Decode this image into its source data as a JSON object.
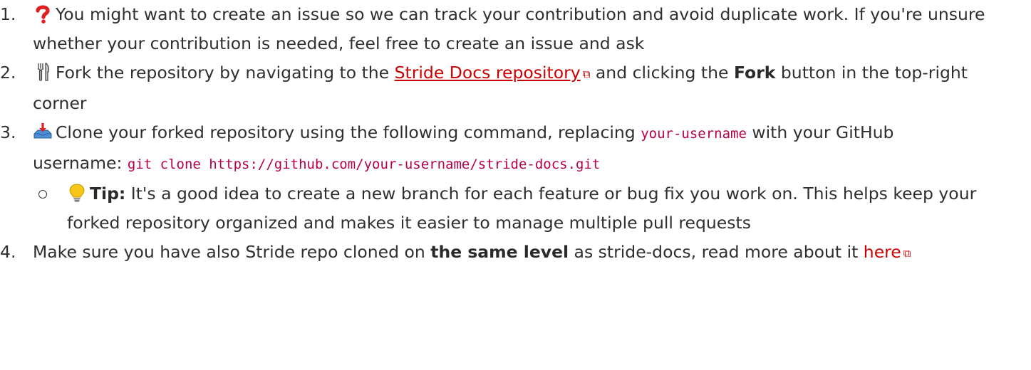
{
  "items": [
    {
      "number": "1.",
      "icon": "question-mark-icon",
      "text": "You might want to create an issue so we can track your contribution and avoid duplicate work. If you're unsure whether your contribution is needed, feel free to create an issue and ask"
    },
    {
      "number": "2.",
      "icon": "fork-and-knife-icon",
      "text_before": "Fork the repository by navigating to the ",
      "link_text": "Stride Docs repository",
      "text_middle": " and clicking the ",
      "bold": "Fork",
      "text_after": " button in the top-right corner"
    },
    {
      "number": "3.",
      "icon": "inbox-tray-icon",
      "text_before": "Clone your forked repository using the following command, replacing ",
      "code1": "your-username",
      "text_middle": " with your GitHub username: ",
      "code2": "git clone https://github.com/your-username/stride-docs.git",
      "tip": {
        "icon": "lightbulb-icon",
        "label": "Tip:",
        "text": " It's a good idea to create a new branch for each feature or bug fix you work on. This helps keep your forked repository organized and makes it easier to manage multiple pull requests"
      }
    },
    {
      "number": "4.",
      "text_before": "Make sure you have also Stride repo cloned on ",
      "bold": "the same level",
      "text_after": " as stride-docs, read more about it ",
      "link_text": "here"
    }
  ],
  "colors": {
    "text": "#2f2f2f",
    "link": "#cc0000",
    "code": "#b5004a",
    "question_mark": "#e02020",
    "lightbulb": "#f5c518"
  }
}
